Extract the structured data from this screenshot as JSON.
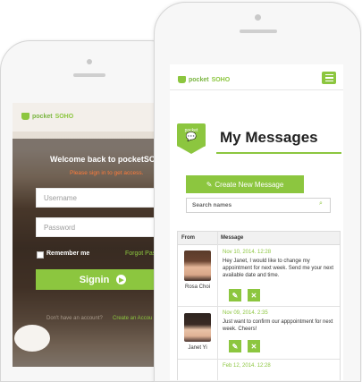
{
  "brand": {
    "name_prefix": "pocket",
    "name_suffix": "SOHO"
  },
  "login": {
    "welcome": "Welcome back to pocketSOHO",
    "subtitle": "Please sign in to get access.",
    "username_placeholder": "Username",
    "password_placeholder": "Password",
    "remember": "Remember me",
    "forgot": "Forgot Pass",
    "signin": "Signin",
    "no_account": "Don't have an account?",
    "create_account": "Create an Accou"
  },
  "messages": {
    "badge": "pocket",
    "title": "My Messages",
    "create_button": "Create New Message",
    "search_placeholder": "Search names",
    "col_from": "From",
    "col_message": "Message",
    "rows": [
      {
        "name": "Rosa Choi",
        "date": "Nov 10, 2014. 12:28",
        "text": "Hey Janet, I would like to change my appointment for next week. Send me your next available date and time."
      },
      {
        "name": "Janet Yi",
        "date": "Nov 09, 2014. 2:35",
        "text": "Just want to confirm our apppointment for next week. Cheers!"
      },
      {
        "name": "",
        "date": "Feb 12, 2014. 12:28",
        "text": ""
      }
    ]
  },
  "colors": {
    "accent": "#8cc63f"
  }
}
